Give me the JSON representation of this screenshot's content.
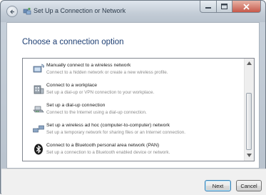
{
  "window": {
    "title": "Set Up a Connection or Network"
  },
  "page": {
    "heading": "Choose a connection option"
  },
  "options": [
    {
      "title": "Manually connect to a wireless network",
      "description": "Connect to a hidden network or create a new wireless profile.",
      "icon": "wireless-network-icon"
    },
    {
      "title": "Connect to a workplace",
      "description": "Set up a dial-up or VPN connection to your workplace.",
      "icon": "workplace-icon"
    },
    {
      "title": "Set up a dial-up connection",
      "description": "Connect to the Internet using a dial-up connection.",
      "icon": "dialup-modem-icon"
    },
    {
      "title": "Set up a wireless ad hoc (computer-to-computer) network",
      "description": "Set up a temporary network for sharing files or an Internet connection.",
      "icon": "adhoc-network-icon"
    },
    {
      "title": "Connect to a Bluetooth personal area network (PAN)",
      "description": "Set up a connection to a Bluetooth enabled device or network.",
      "icon": "bluetooth-icon"
    }
  ],
  "buttons": {
    "next": "Next",
    "cancel": "Cancel"
  }
}
